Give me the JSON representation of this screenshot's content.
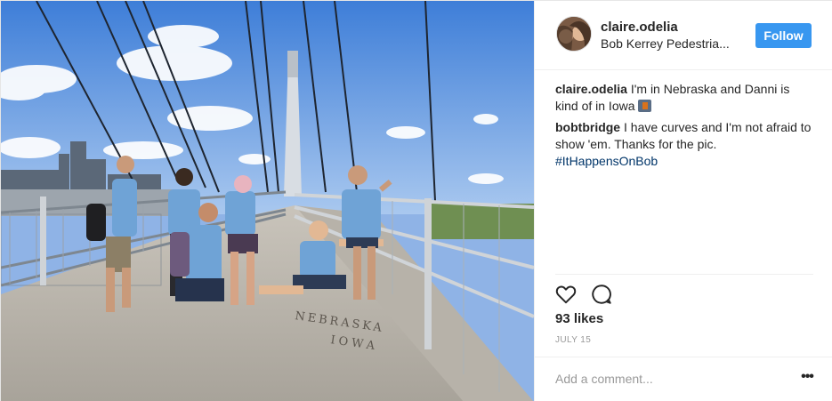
{
  "post": {
    "username": "claire.odelia",
    "location": "Bob Kerrey Pedestria...",
    "follow_label": "Follow",
    "comments": [
      {
        "user": "claire.odelia",
        "text": "I'm in Nebraska and Danni is kind of in Iowa"
      },
      {
        "user": "bobtbridge",
        "text": "I have curves and I'm not afraid to show 'em. Thanks for the pic.",
        "hashtag": "#ItHappensOnBob"
      }
    ],
    "likes": "93 likes",
    "date": "JULY 15",
    "comment_placeholder": "Add a comment...",
    "more_label": "•••",
    "photo_text": {
      "nebraska": "NEBRASKA",
      "iowa": "IOWA"
    }
  },
  "colors": {
    "follow_bg": "#3897f0",
    "hashtag": "#003569",
    "border": "#efefef"
  },
  "icons": [
    "heart-icon",
    "comment-icon",
    "more-options-icon",
    "state-flag-emoji"
  ]
}
